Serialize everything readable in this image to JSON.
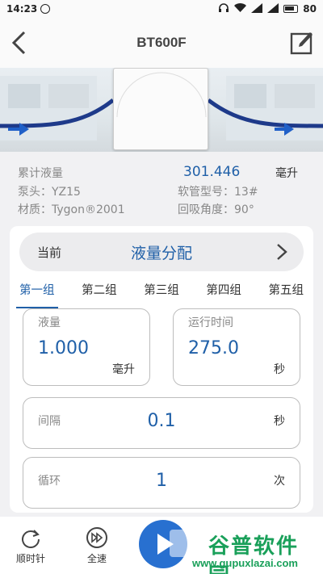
{
  "status": {
    "time": "14:23",
    "battery": "80"
  },
  "header": {
    "title": "BT600F"
  },
  "info": {
    "cumulative_label": "累计液量",
    "cumulative_value": "301.446",
    "cumulative_unit": "毫升",
    "pump_head": "泵头：YZ15",
    "tube_model": "软管型号：13#",
    "material": "材质：Tygon®2001",
    "suction_angle": "回吸角度：90°"
  },
  "mode": {
    "current_label": "当前",
    "value": "液量分配"
  },
  "tabs": [
    "第一组",
    "第二组",
    "第三组",
    "第四组",
    "第五组"
  ],
  "fields": {
    "volume": {
      "label": "液量",
      "value": "1.000",
      "unit": "毫升"
    },
    "run_time": {
      "label": "运行时间",
      "value": "275.0",
      "unit": "秒"
    },
    "interval": {
      "label": "间隔",
      "value": "0.1",
      "unit": "秒"
    },
    "cycle": {
      "label": "循环",
      "value": "1",
      "unit": "次"
    }
  },
  "bottom": {
    "clockwise": "顺时针",
    "full_speed": "全速"
  },
  "watermark": {
    "brand": "谷普软件园",
    "url": "www.gupuxlazai.com"
  },
  "colors": {
    "accent": "#2060a8",
    "play": "#2870d0"
  }
}
